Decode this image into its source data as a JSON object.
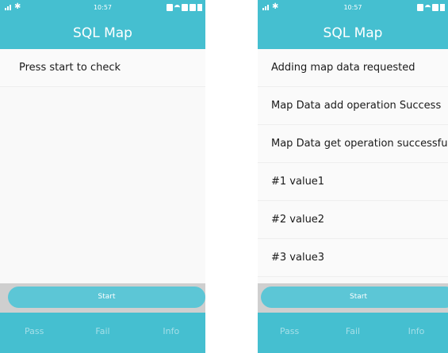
{
  "left_screen": {
    "status": {
      "time": "10:57"
    },
    "title": "SQL Map",
    "items": [
      "Press start to check"
    ],
    "start_label": "Start",
    "tabs": [
      "Pass",
      "Fail",
      "Info"
    ]
  },
  "right_screen": {
    "status": {
      "time": "10:57"
    },
    "title": "SQL Map",
    "items": [
      "Adding map data requested",
      "Map Data add operation Success",
      "Map Data get operation successful.",
      "#1 value1",
      "#2 value2",
      "#3 value3"
    ],
    "start_label": "Start",
    "tabs": [
      "Pass",
      "Fail",
      "Info"
    ]
  },
  "colors": {
    "accent": "#45bfd0",
    "button": "#5cc6d6",
    "tab_text": "#a6dfe8"
  },
  "icons": [
    "signal-icon",
    "bluetooth-icon",
    "wifi-icon",
    "battery-icon"
  ]
}
